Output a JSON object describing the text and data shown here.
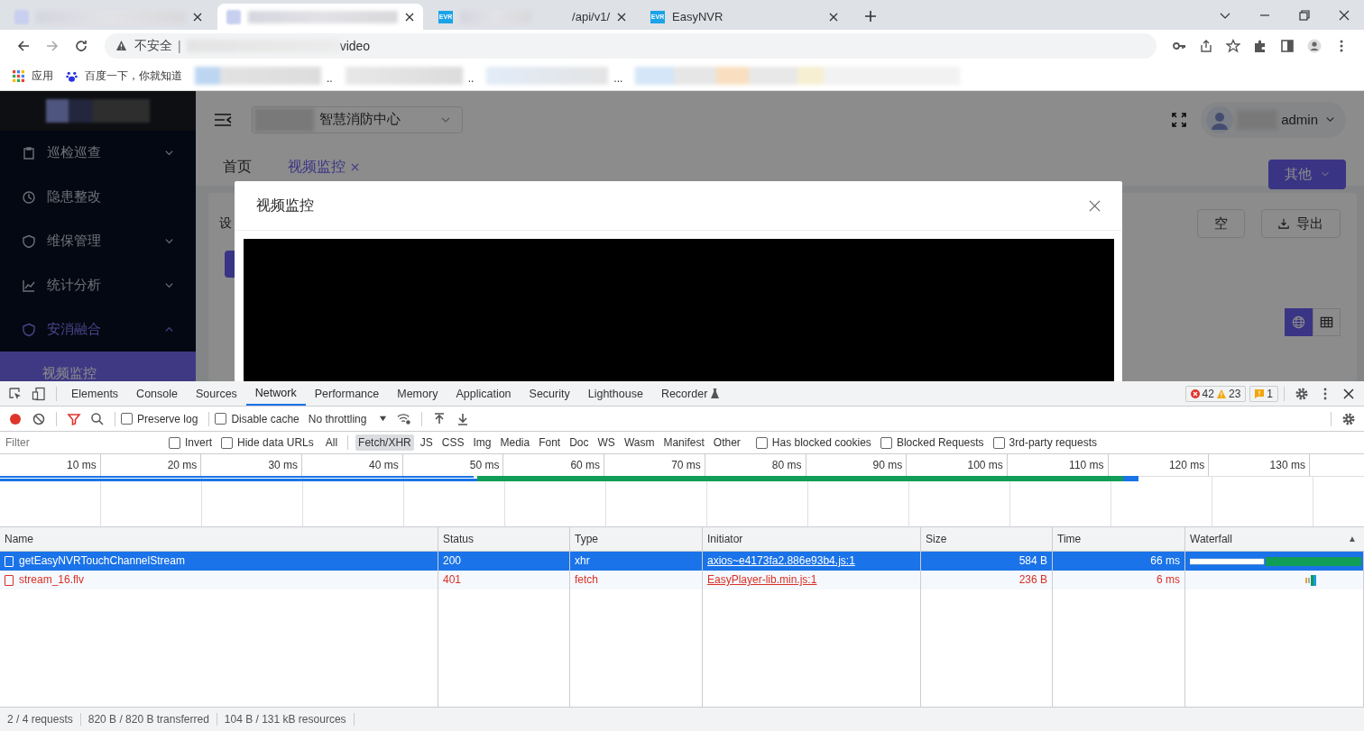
{
  "browser": {
    "tabs": [
      {
        "kind": "blurred",
        "selected": false
      },
      {
        "kind": "blurred",
        "selected": true
      },
      {
        "kind": "titled",
        "favicon": "EVR",
        "title": "/api/v1/",
        "selected": false
      },
      {
        "kind": "titled",
        "favicon": "EVR",
        "title": "EasyNVR",
        "selected": false
      }
    ],
    "address": {
      "security": "不安全",
      "separator": "|",
      "url_end": "video"
    },
    "bookmarks": [
      {
        "kind": "apps",
        "label": "应用"
      },
      {
        "kind": "baidu",
        "label": "百度一下，你就知道"
      },
      {
        "kind": "blurred",
        "label": ".."
      },
      {
        "kind": "blurred",
        "label": ".."
      },
      {
        "kind": "blurred",
        "label": "..."
      },
      {
        "kind": "blurred"
      }
    ]
  },
  "app": {
    "sidebar": {
      "items": [
        {
          "label": "巡检巡查",
          "kind": "group",
          "expanded": false,
          "selected": false
        },
        {
          "label": "隐患整改",
          "kind": "link",
          "selected": false
        },
        {
          "label": "维保管理",
          "kind": "group",
          "expanded": false,
          "selected": false
        },
        {
          "label": "统计分析",
          "kind": "group",
          "expanded": false,
          "selected": false
        },
        {
          "label": "安消融合",
          "kind": "group",
          "expanded": true,
          "selected": true,
          "children": [
            {
              "label": "视频监控",
              "selected": true
            }
          ]
        }
      ]
    },
    "header": {
      "location": "智慧消防中心",
      "user": "admin"
    },
    "page_tabs": [
      {
        "label": "首页",
        "selected": false,
        "closable": false
      },
      {
        "label": "视频监控",
        "selected": true,
        "closable": true
      }
    ],
    "other_button": "其他",
    "content": {
      "label": "设",
      "buttons": [
        {
          "label": "空",
          "kind": "plain"
        },
        {
          "label": "导出",
          "kind": "download"
        }
      ],
      "views": [
        {
          "kind": "globe",
          "selected": true
        },
        {
          "kind": "table",
          "selected": false
        }
      ]
    },
    "modal": {
      "title": "视频监控"
    }
  },
  "devtools": {
    "panels": [
      {
        "label": "Elements",
        "selected": false,
        "kind": "plain"
      },
      {
        "label": "Console",
        "selected": false,
        "kind": "plain"
      },
      {
        "label": "Sources",
        "selected": false,
        "kind": "plain"
      },
      {
        "label": "Network",
        "selected": true,
        "kind": "plain"
      },
      {
        "label": "Performance",
        "selected": false,
        "kind": "plain"
      },
      {
        "label": "Memory",
        "selected": false,
        "kind": "plain"
      },
      {
        "label": "Application",
        "selected": false,
        "kind": "plain"
      },
      {
        "label": "Security",
        "selected": false,
        "kind": "plain"
      },
      {
        "label": "Lighthouse",
        "selected": false,
        "kind": "plain"
      },
      {
        "label": "Recorder",
        "selected": false,
        "kind": "experimental"
      }
    ],
    "errors": "42",
    "warnings": "23",
    "issues": "1",
    "recording": true,
    "toolbar_checks": [
      {
        "label": "Preserve log",
        "checked": false
      },
      {
        "label": "Disable cache",
        "checked": false
      }
    ],
    "throttling": "No throttling",
    "filter": {
      "placeholder": "Filter",
      "checks": [
        {
          "label": "Invert",
          "checked": false
        },
        {
          "label": "Hide data URLs",
          "checked": false
        }
      ],
      "types": [
        {
          "label": "All",
          "selected": false
        },
        {
          "label": "Fetch/XHR",
          "selected": true
        },
        {
          "label": "JS",
          "selected": false
        },
        {
          "label": "CSS",
          "selected": false
        },
        {
          "label": "Img",
          "selected": false
        },
        {
          "label": "Media",
          "selected": false
        },
        {
          "label": "Font",
          "selected": false
        },
        {
          "label": "Doc",
          "selected": false
        },
        {
          "label": "WS",
          "selected": false
        },
        {
          "label": "Wasm",
          "selected": false
        },
        {
          "label": "Manifest",
          "selected": false
        },
        {
          "label": "Other",
          "selected": false
        }
      ],
      "extra": [
        {
          "label": "Has blocked cookies",
          "checked": false
        },
        {
          "label": "Blocked Requests",
          "checked": false
        },
        {
          "label": "3rd-party requests",
          "checked": false
        }
      ]
    },
    "overview_ticks": [
      "10 ms",
      "20 ms",
      "30 ms",
      "40 ms",
      "50 ms",
      "60 ms",
      "70 ms",
      "80 ms",
      "90 ms",
      "100 ms",
      "110 ms",
      "120 ms",
      "130 ms"
    ],
    "columns": [
      "Name",
      "Status",
      "Type",
      "Initiator",
      "Size",
      "Time",
      "Waterfall"
    ],
    "sort_mark": "▲",
    "rows": [
      {
        "name": "getEasyNVRTouchChannelStream",
        "status": "200",
        "type": "xhr",
        "initiator": "axios~e4173fa2.886e93b4.js:1",
        "size": "584 B",
        "time": "66 ms",
        "selected": true,
        "failed": false
      },
      {
        "name": "stream_16.flv",
        "status": "401",
        "type": "fetch",
        "initiator": "EasyPlayer-lib.min.js:1",
        "size": "236 B",
        "time": "6 ms",
        "selected": false,
        "failed": true
      }
    ],
    "summary": [
      "2 / 4 requests",
      "820 B / 820 B transferred",
      "104 B / 131 kB resources"
    ]
  }
}
